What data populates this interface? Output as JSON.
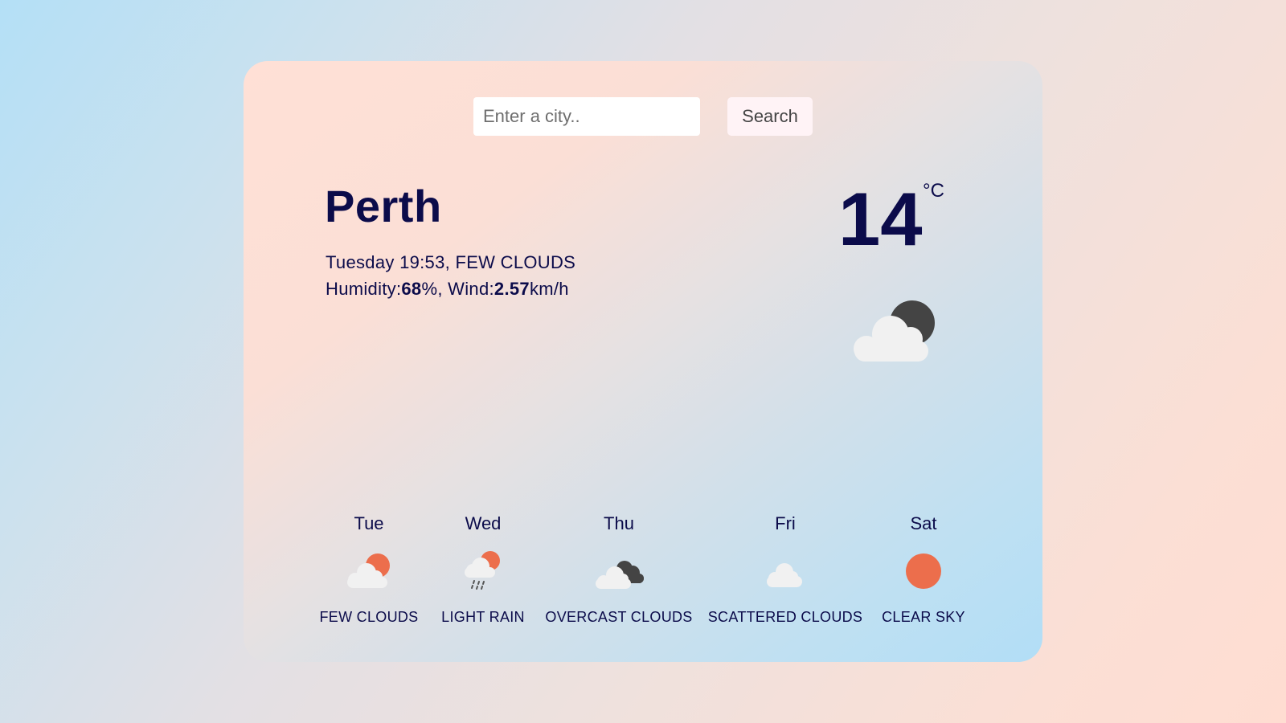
{
  "search": {
    "placeholder": "Enter a city..",
    "value": "",
    "button_label": "Search"
  },
  "current": {
    "city": "Perth",
    "date_desc": "Tuesday 19:53, FEW CLOUDS",
    "humidity_label": "Humidity:",
    "humidity_value": "68",
    "humidity_unit": "%",
    "wind_label": ", Wind:",
    "wind_value": "2.57",
    "wind_unit": "km/h",
    "temperature": "14",
    "unit": "°C",
    "icon": "few-clouds-night-icon"
  },
  "forecast": [
    {
      "day": "Tue",
      "description": "FEW CLOUDS",
      "icon": "few-clouds-icon"
    },
    {
      "day": "Wed",
      "description": "LIGHT RAIN",
      "icon": "light-rain-icon"
    },
    {
      "day": "Thu",
      "description": "OVERCAST CLOUDS",
      "icon": "overcast-clouds-icon"
    },
    {
      "day": "Fri",
      "description": "SCATTERED CLOUDS",
      "icon": "scattered-clouds-icon"
    },
    {
      "day": "Sat",
      "description": "CLEAR SKY",
      "icon": "clear-sky-icon"
    }
  ],
  "colors": {
    "text": "#0b0b4a",
    "sun": "#ec6e4c",
    "cloud": "#f1f1f1",
    "dark_cloud": "#444444"
  }
}
